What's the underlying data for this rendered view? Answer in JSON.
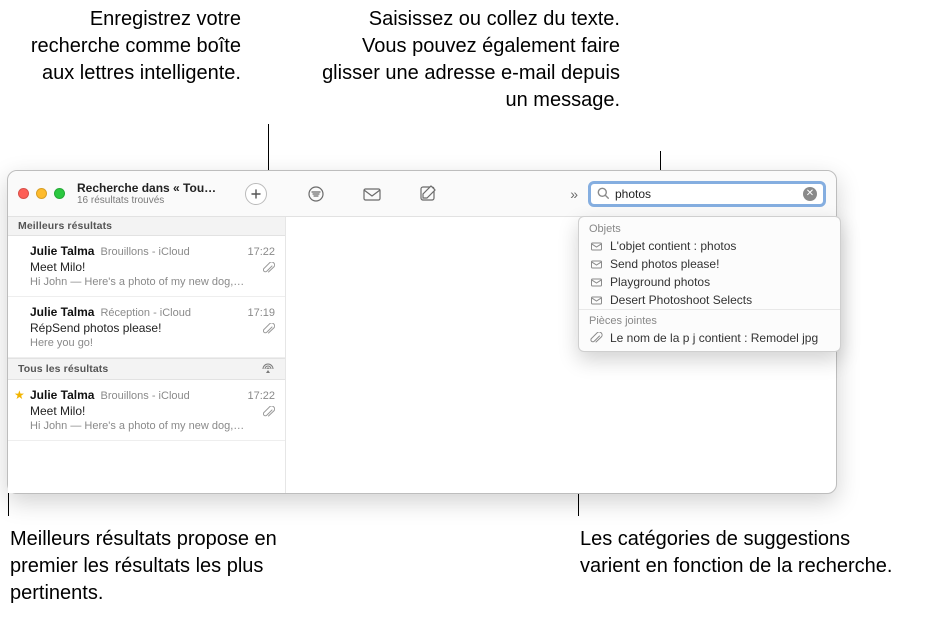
{
  "callouts": {
    "smart_mailbox": "Enregistrez votre recherche comme boîte aux lettres intelligente.",
    "search_hint": "Saisissez ou collez du texte.\nVous pouvez également faire glisser une adresse e-mail depuis un message.",
    "top_hits": "Meilleurs résultats propose en premier les résultats les plus pertinents.",
    "categories_vary": "Les catégories de suggestions varient en fonction de la recherche."
  },
  "window": {
    "title": "Recherche dans « Tou…",
    "subtitle": "16 résultats trouvés",
    "search_value": "photos"
  },
  "sections": {
    "best": {
      "label": "Meilleurs résultats"
    },
    "all": {
      "label": "Tous les résultats"
    }
  },
  "messages": {
    "best": [
      {
        "sender": "Julie Talma",
        "source": "Brouillons - iCloud",
        "time": "17:22",
        "subject": "Meet Milo!",
        "preview": "Hi John — Here's a photo of my new dog,…",
        "attachment": true,
        "starred": false
      },
      {
        "sender": "Julie Talma",
        "source": "Réception - iCloud",
        "time": "17:19",
        "subject": "RépSend photos please!",
        "preview": "Here you go!",
        "attachment": true,
        "starred": false
      }
    ],
    "all": [
      {
        "sender": "Julie Talma",
        "source": "Brouillons - iCloud",
        "time": "17:22",
        "subject": "Meet Milo!",
        "preview": "Hi John — Here's a photo of my new dog,…",
        "attachment": true,
        "starred": true
      }
    ]
  },
  "suggestions": {
    "objects_label": "Objets",
    "objects": [
      "L'objet contient : photos",
      "Send photos please!",
      "Playground photos",
      "Desert Photoshoot Selects"
    ],
    "attachments_label": "Pièces jointes",
    "attachments": [
      "Le nom de la p j contient : Remodel jpg"
    ]
  }
}
